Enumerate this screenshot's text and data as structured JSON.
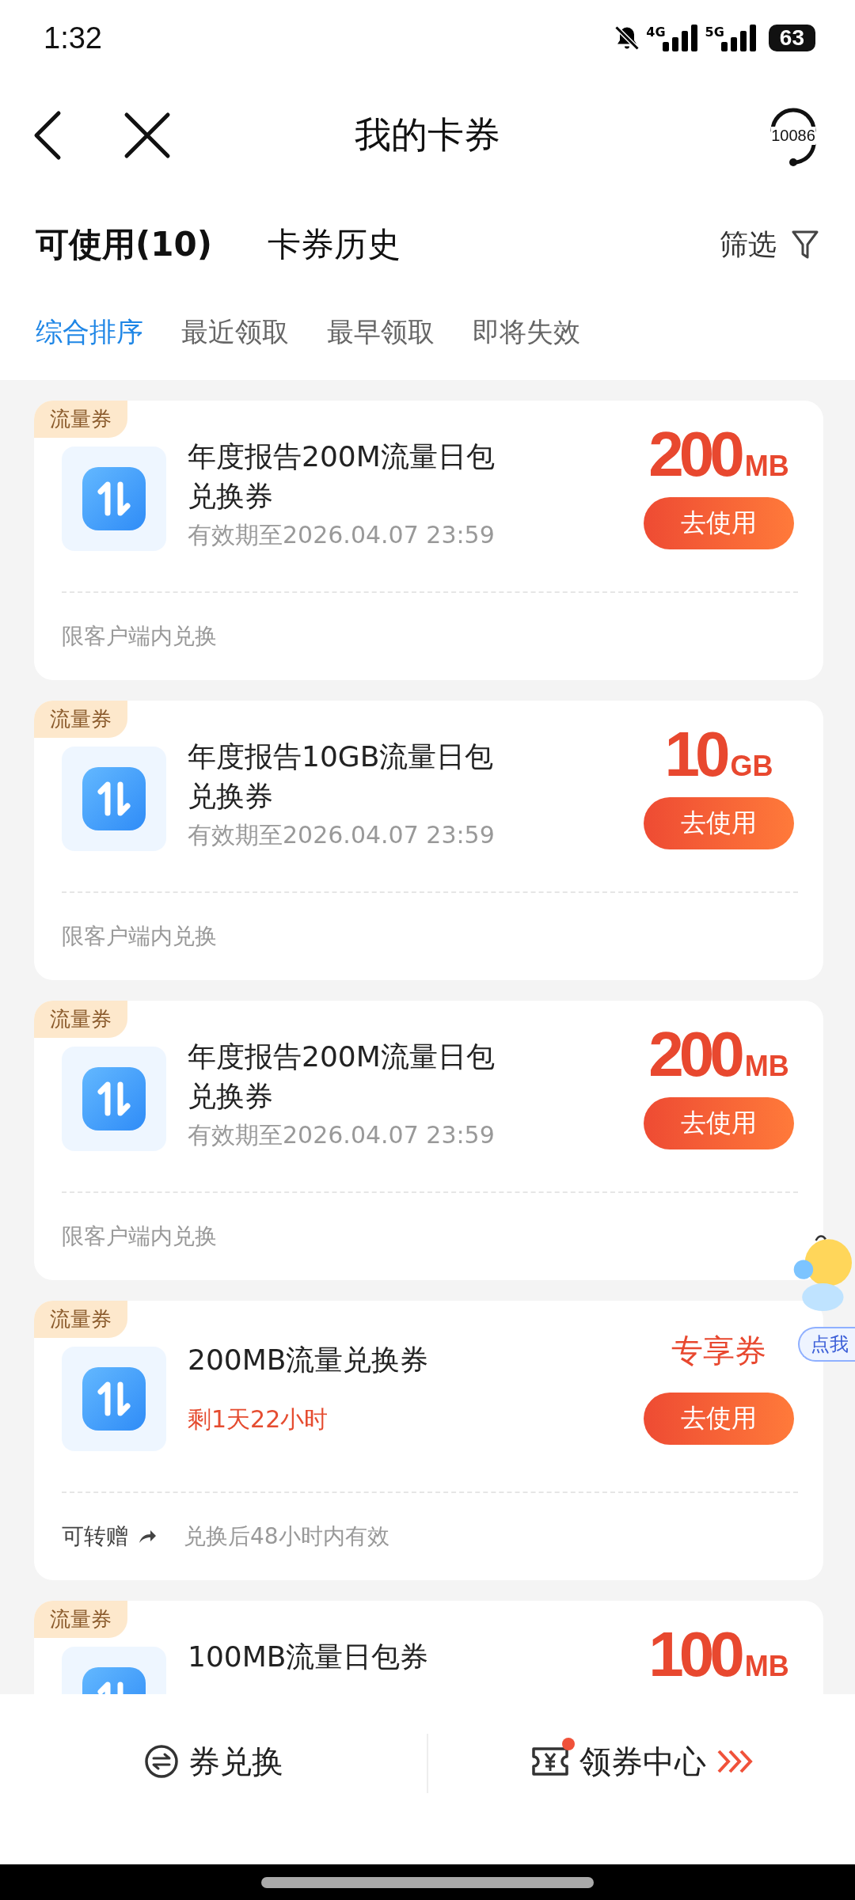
{
  "status_bar": {
    "time": "1:32",
    "network_1": "4G",
    "network_2": "5G",
    "battery": "63"
  },
  "header": {
    "title": "我的卡券",
    "hotline": "10086"
  },
  "tabs": [
    {
      "label": "可使用(10)",
      "selected": true
    },
    {
      "label": "卡券历史",
      "selected": false
    }
  ],
  "filter": {
    "label": "筛选"
  },
  "sort_options": [
    {
      "label": "综合排序",
      "selected": true
    },
    {
      "label": "最近领取",
      "selected": false
    },
    {
      "label": "最早领取",
      "selected": false
    },
    {
      "label": "即将失效",
      "selected": false
    }
  ],
  "coupons": [
    {
      "kind": "dated",
      "tag": "流量券",
      "title": "年度报告200M流量日包兑换券",
      "expiry": "有效期至2026.04.07 23:59",
      "amount": "200",
      "unit": "MB",
      "button": "去使用",
      "note": "限客户端内兑换"
    },
    {
      "kind": "dated",
      "tag": "流量券",
      "title": "年度报告10GB流量日包兑换券",
      "expiry": "有效期至2026.04.07 23:59",
      "amount": "10",
      "unit": "GB",
      "button": "去使用",
      "note": "限客户端内兑换"
    },
    {
      "kind": "dated",
      "tag": "流量券",
      "title": "年度报告200M流量日包兑换券",
      "expiry": "有效期至2026.04.07 23:59",
      "amount": "200",
      "unit": "MB",
      "button": "去使用",
      "note": "限客户端内兑换"
    },
    {
      "kind": "timed",
      "tag": "流量券",
      "title": "200MB流量兑换券",
      "countdown": "剩1天22小时",
      "badge": "专享券",
      "button": "去使用",
      "transfer": "可转赠",
      "note": "兑换后48小时内有效"
    },
    {
      "kind": "dated",
      "tag": "流量券",
      "title": "100MB流量日包券",
      "amount": "100",
      "unit": "MB"
    }
  ],
  "floating_bubble": {
    "label": "点我"
  },
  "bottom_bar": {
    "exchange": "券兑换",
    "center": "领券中心",
    "center_dot": true
  }
}
